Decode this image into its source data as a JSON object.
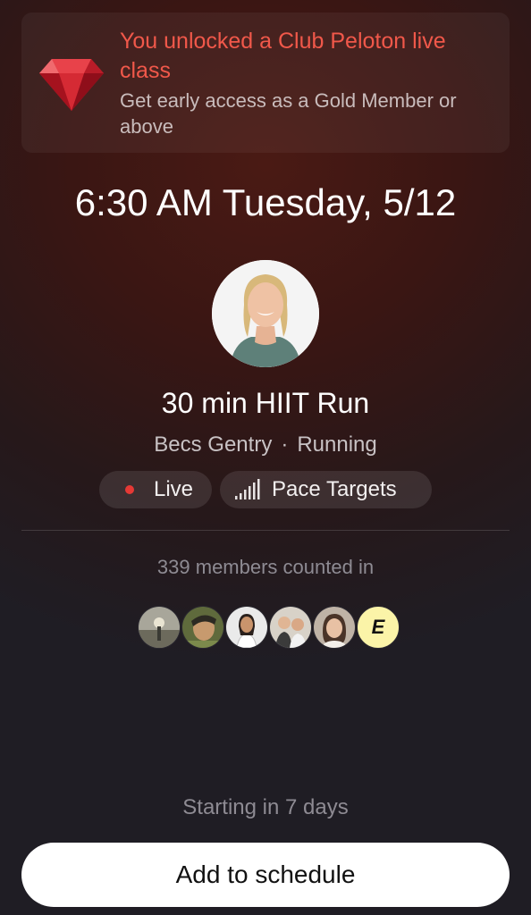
{
  "banner": {
    "icon": "ruby-gem-icon",
    "title": "You unlocked a Club Peloton live class",
    "subtitle": "Get early access as a Gold Member or above",
    "title_color": "#f0584a"
  },
  "class": {
    "datetime": "6:30 AM Tuesday, 5/12",
    "title": "30 min HIIT Run",
    "instructor": "Becs Gentry",
    "separator": "·",
    "discipline": "Running",
    "badges": {
      "live": "Live",
      "pace": "Pace Targets"
    },
    "live_color": "#e53935"
  },
  "members": {
    "count_text": "339 members counted in",
    "avatars": [
      "member-avatar-1",
      "member-avatar-2",
      "member-avatar-3",
      "member-avatar-4",
      "member-avatar-5"
    ],
    "initial": "E"
  },
  "footer": {
    "starting_text": "Starting in 7 days",
    "button_label": "Add to schedule"
  }
}
